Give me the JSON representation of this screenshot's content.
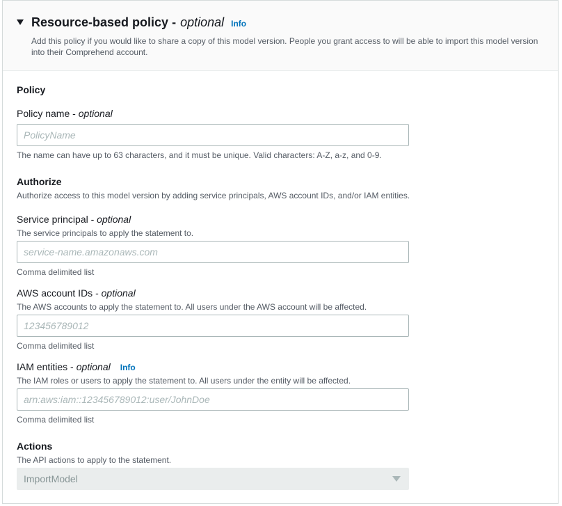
{
  "header": {
    "title": "Resource-based policy -",
    "title_optional": "optional",
    "info_label": "Info",
    "description": "Add this policy if you would like to share a copy of this model version. People you grant access to will be able to import this model version into their Comprehend account."
  },
  "policy_section": {
    "heading": "Policy",
    "name_label": "Policy name -",
    "name_optional": "optional",
    "name_placeholder": "PolicyName",
    "name_value": "",
    "name_hint": "The name can have up to 63 characters, and it must be unique. Valid characters: A-Z, a-z, and 0-9."
  },
  "authorize_section": {
    "heading": "Authorize",
    "description": "Authorize access to this model version by adding service principals, AWS account IDs, and/or IAM entities.",
    "service_principal": {
      "label": "Service principal -",
      "optional": "optional",
      "description": "The service principals to apply the statement to.",
      "placeholder": "service-name.amazonaws.com",
      "value": "",
      "hint": "Comma delimited list"
    },
    "account_ids": {
      "label": "AWS account IDs -",
      "optional": "optional",
      "description": "The AWS accounts to apply the statement to. All users under the AWS account will be affected.",
      "placeholder": "123456789012",
      "value": "",
      "hint": "Comma delimited list"
    },
    "iam_entities": {
      "label": "IAM entities -",
      "optional": "optional",
      "info_label": "Info",
      "description": "The IAM roles or users to apply the statement to. All users under the entity will be affected.",
      "placeholder": "arn:aws:iam::123456789012:user/JohnDoe",
      "value": "",
      "hint": "Comma delimited list"
    }
  },
  "actions_section": {
    "heading": "Actions",
    "description": "The API actions to apply to the statement.",
    "selected_value": "ImportModel"
  },
  "icons": {
    "section_toggle": "caret-down-icon",
    "select_arrow": "caret-down-icon"
  },
  "colors": {
    "link": "#0073bb",
    "text": "#16191f",
    "secondary_text": "#545b64",
    "border": "#aab7b8",
    "disabled_bg": "#eaeded"
  }
}
